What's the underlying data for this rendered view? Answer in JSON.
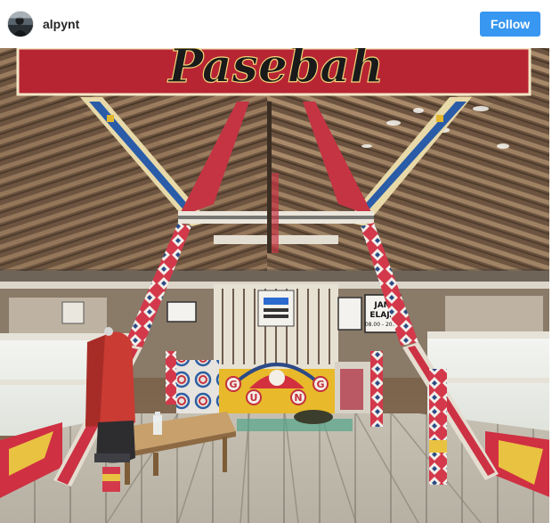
{
  "post": {
    "username": "alpynt",
    "follow_label": "Follow",
    "follow_color": "#3897f0"
  },
  "photo": {
    "banner_text": "Pasebah",
    "sign_lines": [
      "JAM",
      "ELAJA",
      "08.00 - 20.00"
    ],
    "gate_letters": [
      "G",
      "U",
      "N",
      "G"
    ]
  },
  "icons": {
    "avatar": "profile-avatar"
  }
}
